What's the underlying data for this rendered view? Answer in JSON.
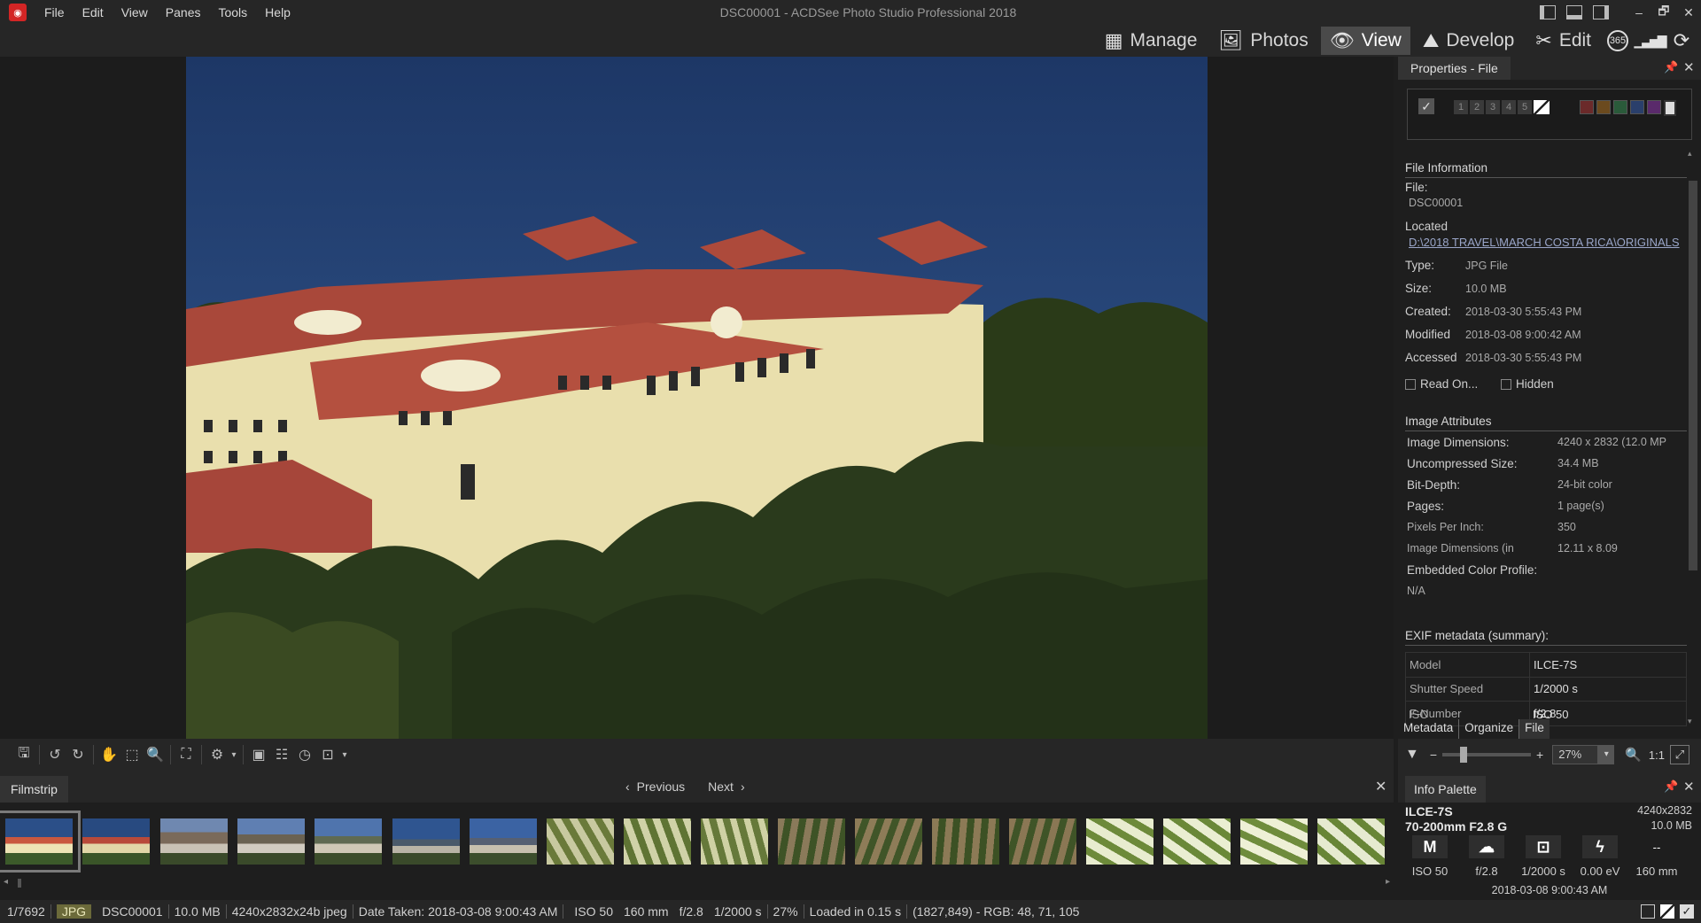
{
  "window": {
    "title": "DSC00001 - ACDSee Photo Studio Professional 2018"
  },
  "menu": [
    "File",
    "Edit",
    "View",
    "Panes",
    "Tools",
    "Help"
  ],
  "window_controls": {
    "minimize": "–",
    "maximize": "🗗",
    "close": "✕"
  },
  "modes": [
    {
      "label": "Manage",
      "icon": "▦",
      "active": false
    },
    {
      "label": "Photos",
      "icon": "🖼",
      "active": false
    },
    {
      "label": "View",
      "icon": "👁",
      "active": true
    },
    {
      "label": "Develop",
      "icon": "⛰",
      "active": false
    },
    {
      "label": "Edit",
      "icon": "✂",
      "active": false
    }
  ],
  "extra_mode_icons": [
    {
      "name": "365",
      "glyph": "365"
    },
    {
      "name": "dashboard",
      "glyph": "▁▃▅▇"
    },
    {
      "name": "eye-refresh",
      "glyph": "⟳"
    }
  ],
  "properties": {
    "tab_title": "Properties - File",
    "rating_numbers": [
      "1",
      "2",
      "3",
      "4",
      "5"
    ],
    "color_labels": [
      "#6b2a2a",
      "#6b4a1e",
      "#2a5a3a",
      "#2a3f6b",
      "#5a2a6b"
    ],
    "file_info_title": "File Information",
    "file_label": "File:",
    "file_value": "DSC00001",
    "located_label": "Located",
    "located_value": "D:\\2018 TRAVEL\\MARCH COSTA RICA\\ORIGINALS",
    "type_label": "Type:",
    "type_value": "JPG File",
    "size_label": "Size:",
    "size_value": "10.0 MB",
    "created_label": "Created:",
    "created_value": "2018-03-30 5:55:43 PM",
    "modified_label": "Modified",
    "modified_value": "2018-03-08 9:00:42 AM",
    "accessed_label": "Accessed",
    "accessed_value": "2018-03-30 5:55:43 PM",
    "readonly_label": "Read On...",
    "hidden_label": "Hidden",
    "image_attr_title": "Image Attributes",
    "attributes": [
      {
        "label": "Image Dimensions:",
        "value": "4240 x 2832 (12.0 MP"
      },
      {
        "label": "Uncompressed Size:",
        "value": "34.4 MB"
      },
      {
        "label": "Bit-Depth:",
        "value": "24-bit color"
      },
      {
        "label": "Pages:",
        "value": "1 page(s)"
      },
      {
        "label": "Pixels Per Inch:",
        "value": "350"
      },
      {
        "label": "Image Dimensions (in",
        "value": "12.11 x 8.09"
      },
      {
        "label": "Embedded Color Profile:",
        "value": ""
      }
    ],
    "color_profile_value": "N/A",
    "exif_title": "EXIF metadata (summary):",
    "exif": [
      {
        "label": "Model",
        "value": "ILCE-7S"
      },
      {
        "label": "Shutter Speed",
        "value": "1/2000 s"
      },
      {
        "label": "F-Number",
        "value": "f/2.8"
      },
      {
        "label": "ISO",
        "value": "ISO 50"
      }
    ],
    "tabs": [
      "Metadata",
      "Organize",
      "File"
    ]
  },
  "zoom": {
    "value": "27%",
    "one_to_one": "1:1"
  },
  "filmstrip": {
    "title": "Filmstrip",
    "previous": "Previous",
    "next": "Next"
  },
  "info_palette": {
    "title": "Info Palette",
    "camera": "ILCE-7S",
    "lens": "70-200mm F2.8 G",
    "dimensions": "4240x2832",
    "size": "10.0 MB",
    "mode": "M",
    "values": [
      "ISO 50",
      "f/2.8",
      "1/2000 s",
      "0.00 eV",
      "160 mm"
    ],
    "extra_dash": "--",
    "date": "2018-03-08 9:00:43 AM"
  },
  "status": {
    "index": "1/7692",
    "format": "JPG",
    "filename": "DSC00001",
    "size": "10.0 MB",
    "dims": "4240x2832x24b jpeg",
    "date_taken": "Date Taken: 2018-03-08 9:00:43 AM",
    "iso": "ISO 50",
    "focal": "160 mm",
    "fnumber": "f/2.8",
    "shutter": "1/2000 s",
    "zoom": "27%",
    "loaded": "Loaded in 0.15 s",
    "pixel": "(1827,849) - RGB: 48, 71, 105"
  }
}
